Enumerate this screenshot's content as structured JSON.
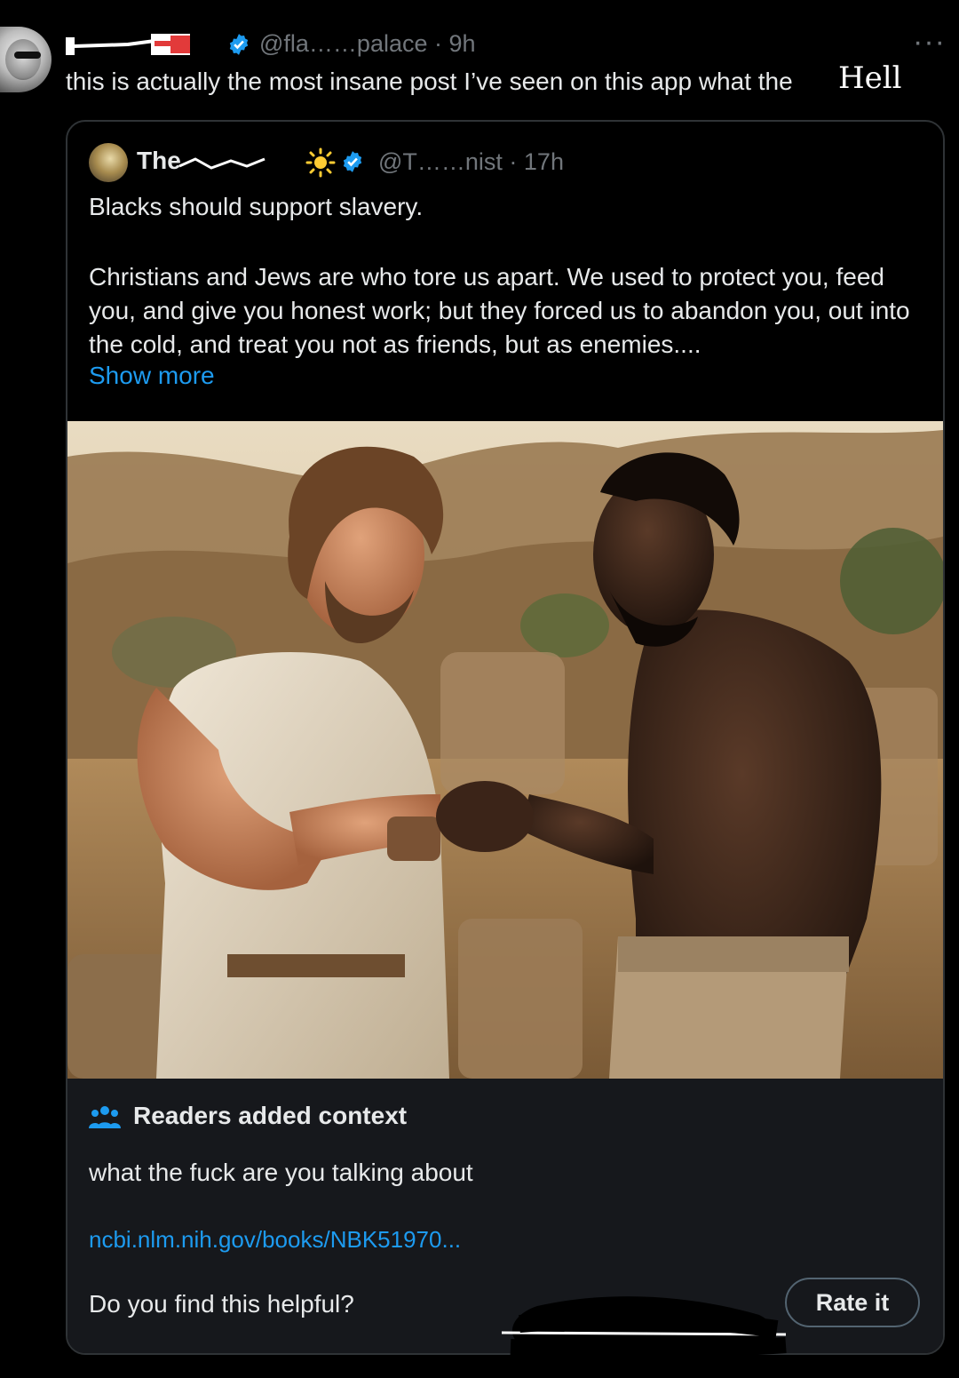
{
  "post": {
    "handle_meta": "@fla……palace · 9h",
    "more": "···",
    "text": "this is actually the most insane post I’ve seen on this app what the",
    "text_overlay": "Hell"
  },
  "quote": {
    "name": "The",
    "handle_meta": "@T……nist · 17h",
    "line1": "Blacks should support slavery.",
    "paragraph": "Christians and Jews are who tore us apart. We used to protect you, feed you, and give you honest work; but they forced us to abandon you, out into the cold, and treat you not as friends, but as enemies....",
    "show_more": "Show more"
  },
  "note": {
    "title": "Readers added context",
    "body": "what the fuck are you talking about",
    "link": "ncbi.nlm.nih.gov/books/NBK51970...",
    "question": "Do you find this helpful?",
    "rate_label": "Rate it"
  },
  "colors": {
    "background": "#000000",
    "text": "#e7e9ea",
    "muted": "#71767b",
    "accent": "#1d9bf0",
    "note_bg": "#16181c",
    "border": "#2f3336"
  },
  "icons": {
    "verified": "verified-badge-icon",
    "sun": "sun-emoji-icon",
    "readers": "people-group-icon",
    "more": "more-options-icon",
    "flag": "flag-icon"
  }
}
